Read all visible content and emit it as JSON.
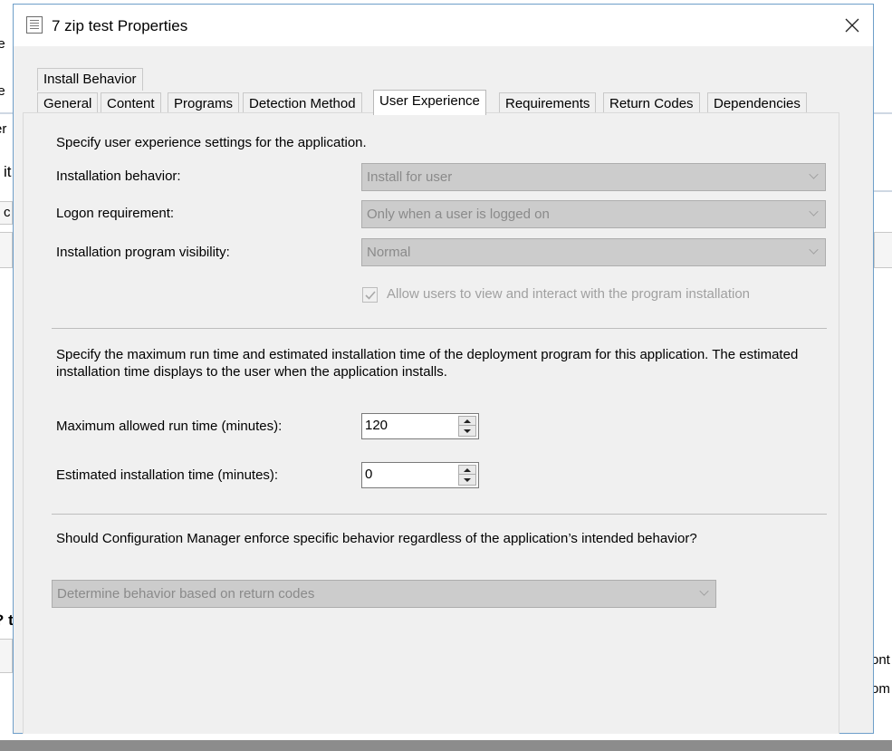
{
  "background": {
    "fragments": [
      "ie",
      "ie",
      "er",
      "it",
      "c",
      "? t",
      "ont",
      "om"
    ]
  },
  "dialog": {
    "title": "7 zip test Properties",
    "close_label": "✕"
  },
  "tabs": {
    "row1": [
      {
        "label": "Install Behavior"
      }
    ],
    "row2": [
      {
        "label": "General"
      },
      {
        "label": "Content"
      },
      {
        "label": "Programs"
      },
      {
        "label": "Detection Method"
      },
      {
        "label": "User Experience"
      },
      {
        "label": "Requirements"
      },
      {
        "label": "Return Codes"
      },
      {
        "label": "Dependencies"
      }
    ],
    "active": "User Experience"
  },
  "user_experience": {
    "intro": "Specify user experience settings for the application.",
    "installation_behavior": {
      "label": "Installation behavior:",
      "value": "Install for user"
    },
    "logon_requirement": {
      "label": "Logon requirement:",
      "value": "Only when a user is logged on"
    },
    "program_visibility": {
      "label": "Installation program visibility:",
      "value": "Normal"
    },
    "allow_interact": {
      "label": "Allow users to view and interact with the program installation",
      "checked": true
    },
    "runtime_intro": "Specify the maximum run time and estimated installation time of the deployment program for this application. The estimated installation time displays to the user when the application installs.",
    "max_runtime": {
      "label": "Maximum allowed run time (minutes):",
      "value": "120"
    },
    "est_time": {
      "label": "Estimated installation time (minutes):",
      "value": "0"
    },
    "enforce_question": "Should Configuration Manager enforce specific behavior regardless of the application’s intended behavior?",
    "enforce_behavior": {
      "value": "Determine behavior based on return codes"
    }
  }
}
